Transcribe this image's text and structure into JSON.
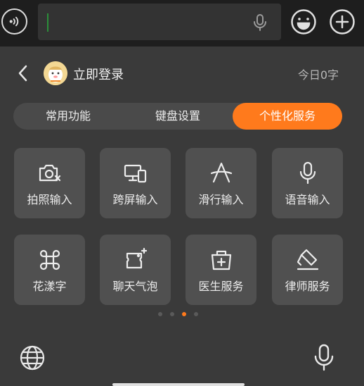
{
  "topbar": {
    "input_text": "",
    "icons": [
      "voice-mode-icon",
      "microphone-icon",
      "emoji-icon",
      "plus-icon"
    ]
  },
  "header": {
    "login_label": "立即登录",
    "word_count": "今日0字"
  },
  "tabs": [
    {
      "label": "常用功能",
      "active": false
    },
    {
      "label": "键盘设置",
      "active": false
    },
    {
      "label": "个性化服务",
      "active": true
    }
  ],
  "tiles": [
    {
      "label": "拍照输入",
      "icon": "camera-text-icon"
    },
    {
      "label": "跨屏输入",
      "icon": "cross-screen-icon"
    },
    {
      "label": "滑行输入",
      "icon": "swipe-input-icon"
    },
    {
      "label": "语音输入",
      "icon": "microphone-icon"
    },
    {
      "label": "花漾字",
      "icon": "command-icon"
    },
    {
      "label": "聊天气泡",
      "icon": "chat-bubble-icon"
    },
    {
      "label": "医生服务",
      "icon": "medical-bag-icon"
    },
    {
      "label": "律师服务",
      "icon": "law-pen-icon"
    }
  ],
  "pagination": {
    "total": 4,
    "active_index": 2
  },
  "colors": {
    "accent": "#ff7a1c",
    "background": "#3a3a3a",
    "tile": "#505050",
    "topbar": "#1e1e1e"
  },
  "bottom": {
    "left_icon": "globe-icon",
    "right_icon": "microphone-icon"
  }
}
